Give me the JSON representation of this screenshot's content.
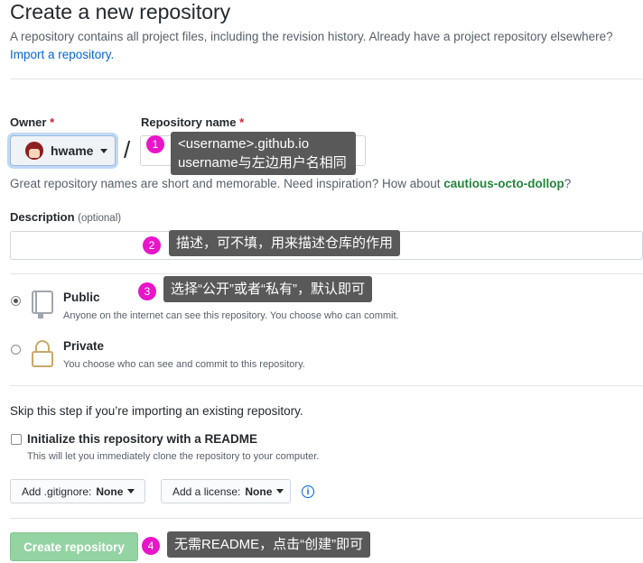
{
  "header": {
    "title": "Create a new repository",
    "subtitle": "A repository contains all project files, including the revision history. Already have a project repository elsewhere?",
    "import_link": "Import a repository."
  },
  "owner": {
    "label": "Owner",
    "required_mark": "*",
    "selected": "hwame"
  },
  "separator": "/",
  "repo_name": {
    "label": "Repository name",
    "required_mark": "*",
    "value": ""
  },
  "suggestion": {
    "text_before": "Great repository names are short and memorable. Need inspiration? How about ",
    "suggested_name": "cautious-octo-dollop",
    "text_after": "?"
  },
  "description": {
    "label": "Description",
    "optional": "(optional)",
    "value": ""
  },
  "visibility": {
    "public": {
      "title": "Public",
      "desc": "Anyone on the internet can see this repository. You choose who can commit.",
      "selected": true
    },
    "private": {
      "title": "Private",
      "desc": "You choose who can see and commit to this repository.",
      "selected": false
    }
  },
  "skip_note": "Skip this step if you’re importing an existing repository.",
  "readme": {
    "label": "Initialize this repository with a README",
    "desc": "This will let you immediately clone the repository to your computer.",
    "checked": false
  },
  "gitignore": {
    "label": "Add .gitignore:",
    "value": "None"
  },
  "license": {
    "label": "Add a license:",
    "value": "None"
  },
  "create_button": "Create repository",
  "annotations": [
    {
      "number": "1",
      "lines": [
        "<username>.github.io",
        "username与左边用户名相同"
      ]
    },
    {
      "number": "2",
      "text": "描述，可不填，用来描述仓库的作用"
    },
    {
      "number": "3",
      "text": "选择“公开”或者“私有”，默认即可"
    },
    {
      "number": "4",
      "text": "无需README，点击“创建”即可"
    }
  ],
  "colors": {
    "annotation_badge": "#e815c9",
    "annotation_box": "#595959",
    "create_button": "#94d3a2",
    "link": "#0366d6",
    "required": "#cb2431"
  }
}
